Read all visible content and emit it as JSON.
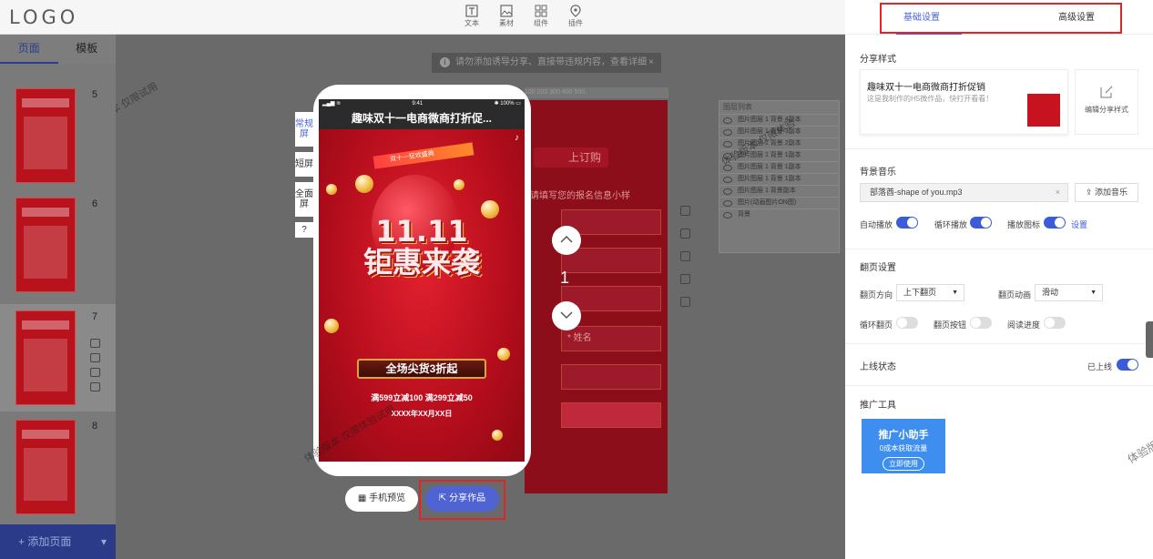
{
  "app": {
    "logo": "LOGO"
  },
  "toolbar": {
    "items": [
      {
        "label": "文本",
        "icon": "text-icon"
      },
      {
        "label": "素材",
        "icon": "material-icon"
      },
      {
        "label": "组件",
        "icon": "component-icon"
      },
      {
        "label": "插件",
        "icon": "plugin-icon"
      }
    ]
  },
  "left_panel": {
    "tabs": [
      "页面",
      "模板"
    ],
    "active_tab": "页面",
    "pages": [
      {
        "num": "5"
      },
      {
        "num": "6"
      },
      {
        "num": "7"
      },
      {
        "num": "8"
      }
    ],
    "add_page_label": "+ 添加页面",
    "add_page_caret": "▾"
  },
  "canvas": {
    "notice": "请勿添加诱导分享、直接带违规内容，查看详细",
    "notice_close": "×",
    "ruler_text": "100    200    300    400    500",
    "bg_button": "上订购",
    "bg_subtitle": "请填写您的报名信息小样",
    "bg_field": "* 姓名",
    "layers_title": "图层列表",
    "layers": [
      "图片图层 1 背景 4副本",
      "图片图层 1 背景 3副本",
      "图片图层 1 背景 2副本",
      "图片图层 1 背景 1副本",
      "图片图层 1 背景 1副本",
      "图片图层 1 背景 1副本",
      "图片图层 1 背景副本",
      "图片(动画图片ON图)",
      "背景"
    ],
    "page_number": "1"
  },
  "phone": {
    "status": {
      "signal": "▂▄▆ ≋",
      "time": "9:41",
      "battery": "✱ 100% ▭"
    },
    "title": "趣味双十一电商微商打折促...",
    "ribbon": "双十一狂欢盛典",
    "big_title_line1": "11.11",
    "big_title_line2": "钜惠来袭",
    "banner": "全场尖货3折起",
    "promo_line1": "满599立减100  满299立减50",
    "promo_line2": "XXXX年XX月XX日",
    "view_tabs": [
      "常规屏",
      "短屏",
      "全面屏",
      "?"
    ],
    "active_view": "常规屏"
  },
  "actions": {
    "preview_label": "手机预览",
    "share_label": "分享作品"
  },
  "watermarks": [
    "体验版本 仅限体验",
    "体验版本 仅限体验试用",
    "体验版本 仅限试用",
    "体验版本 仅限"
  ],
  "settings": {
    "tabs": [
      "基础设置",
      "高级设置"
    ],
    "active_tab": "基础设置",
    "share_style": {
      "title": "分享样式",
      "card_title": "趣味双十一电商微商打折促销",
      "card_desc": "这是我制作的H5微作品，快打开看看！",
      "edit_label": "编辑分享样式"
    },
    "music": {
      "title": "背景音乐",
      "file": "部落酋-shape of you.mp3",
      "clear": "×",
      "add_label": "添加音乐",
      "auto_play": "自动播放",
      "loop_play": "循环播放",
      "play_icon": "播放图标",
      "settings_link": "设置"
    },
    "flip": {
      "title": "翻页设置",
      "direction_label": "翻页方向",
      "direction_value": "上下翻页",
      "animation_label": "翻页动画",
      "animation_value": "滑动",
      "loop_label": "循环翻页",
      "button_label": "翻页按钮",
      "progress_label": "阅读进度"
    },
    "online": {
      "title": "上线状态",
      "status": "已上线"
    },
    "promo": {
      "title": "推广工具",
      "card_title": "推广小助手",
      "card_sub": "0成本获取流量",
      "card_button": "立即使用"
    }
  },
  "colors": {
    "accent": "#4a64d8",
    "highlight": "#e02525",
    "poster": "#b40d1c"
  }
}
